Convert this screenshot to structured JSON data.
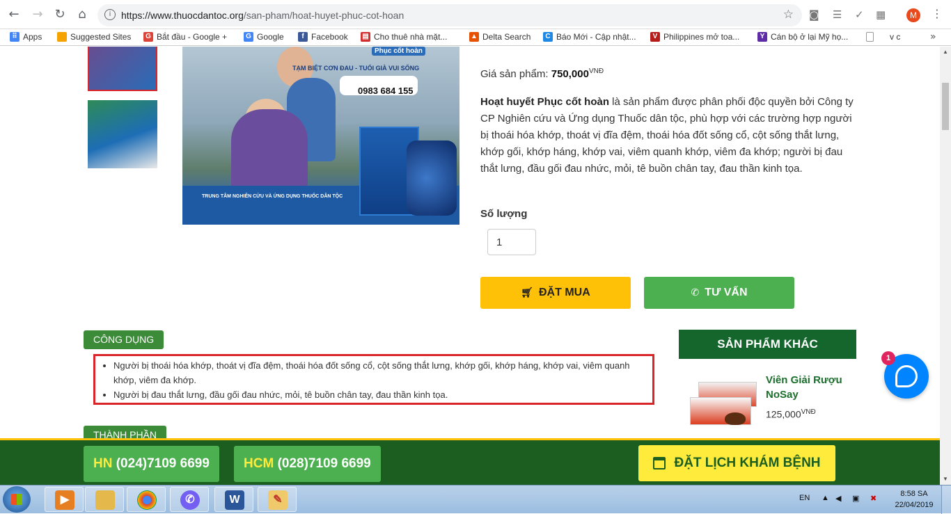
{
  "browser": {
    "url_domain": "https://www.thuocdantoc.org",
    "url_path": "/san-pham/hoat-huyet-phuc-cot-hoan",
    "avatar_letter": "M"
  },
  "bookmarks": [
    {
      "label": "Apps",
      "color": "#4285f4"
    },
    {
      "label": "Suggested Sites",
      "color": "#f4a300"
    },
    {
      "label": "Bắt đầu - Google +",
      "color": "#db4437"
    },
    {
      "label": "Google",
      "color": "#4285f4"
    },
    {
      "label": "Facebook",
      "color": "#3b5998"
    },
    {
      "label": "Cho thuê nhà mặt...",
      "color": "#d32f2f"
    },
    {
      "label": "Delta Search",
      "color": "#e65100"
    },
    {
      "label": "Báo Mới - Cập nhật...",
      "color": "#1e88e5"
    },
    {
      "label": "Philippines mở toa...",
      "color": "#b71c1c"
    },
    {
      "label": "Cán bộ ở lại Mỹ họ...",
      "color": "#5e2ca5"
    },
    {
      "label": "v c",
      "color": "#9e9e9e"
    }
  ],
  "product": {
    "image": {
      "tagline": "TẠM BIỆT CƠN ĐAU - TUỔI GIÀ VUI SỐNG",
      "brand": "Phục cốt hoàn",
      "phone": "0983 684 155",
      "center": "TRUNG TÂM NGHIÊN CỨU VÀ ỨNG DỤNG THUỐC DÂN TỘC"
    },
    "price_label": "Giá sản phẩm:",
    "price_value": "750,000",
    "price_unit": "VNĐ",
    "desc_bold": "Hoạt huyết Phục cốt hoàn",
    "desc_rest": " là sản phẩm được phân phối độc quyền bởi Công ty CP Nghiên cứu và Ứng dụng Thuốc dân tộc, phù hợp với các trường hợp người bị thoái hóa khớp, thoát vị đĩa đệm, thoái hóa đốt sống cổ, cột sống thắt lưng, khớp gối, khớp háng, khớp vai, viêm quanh khớp, viêm đa khớp; người bị đau thắt lưng, đầu gối đau nhức, mỏi, tê buồn chân tay, đau thần kinh tọa.",
    "qty_label": "Số lượng",
    "qty_value": "1",
    "buy_label": "ĐẶT MUA",
    "consult_label": "TƯ VẤN"
  },
  "uses": {
    "tag": "CÔNG DỤNG",
    "items": [
      "Người bị thoái hóa khớp, thoát vị đĩa đệm, thoái hóa đốt sống cổ, cột sống thắt lưng, khớp gối, khớp háng, khớp vai, viêm quanh khớp, viêm đa khớp.",
      "Người bị đau thắt lưng, đầu gối đau nhức, mỏi, tê buồn chân tay, đau thần kinh tọa."
    ]
  },
  "ingredients": {
    "tag": "THÀNH PHẦN"
  },
  "other_products": {
    "title": "SẢN PHẨM KHÁC",
    "items": [
      {
        "name": "Viên Giải Rượu NoSay",
        "price": "125,000",
        "unit": "VNĐ"
      }
    ]
  },
  "messenger": {
    "badge": "1"
  },
  "footer": {
    "hn_city": "HN",
    "hn_phone": "(024)7109 6699",
    "hcm_city": "HCM",
    "hcm_phone": "(028)7109 6699",
    "book_label": "ĐẶT LỊCH KHÁM BỆNH"
  },
  "taskbar": {
    "lang": "EN",
    "time": "8:58 SA",
    "date": "22/04/2019"
  }
}
